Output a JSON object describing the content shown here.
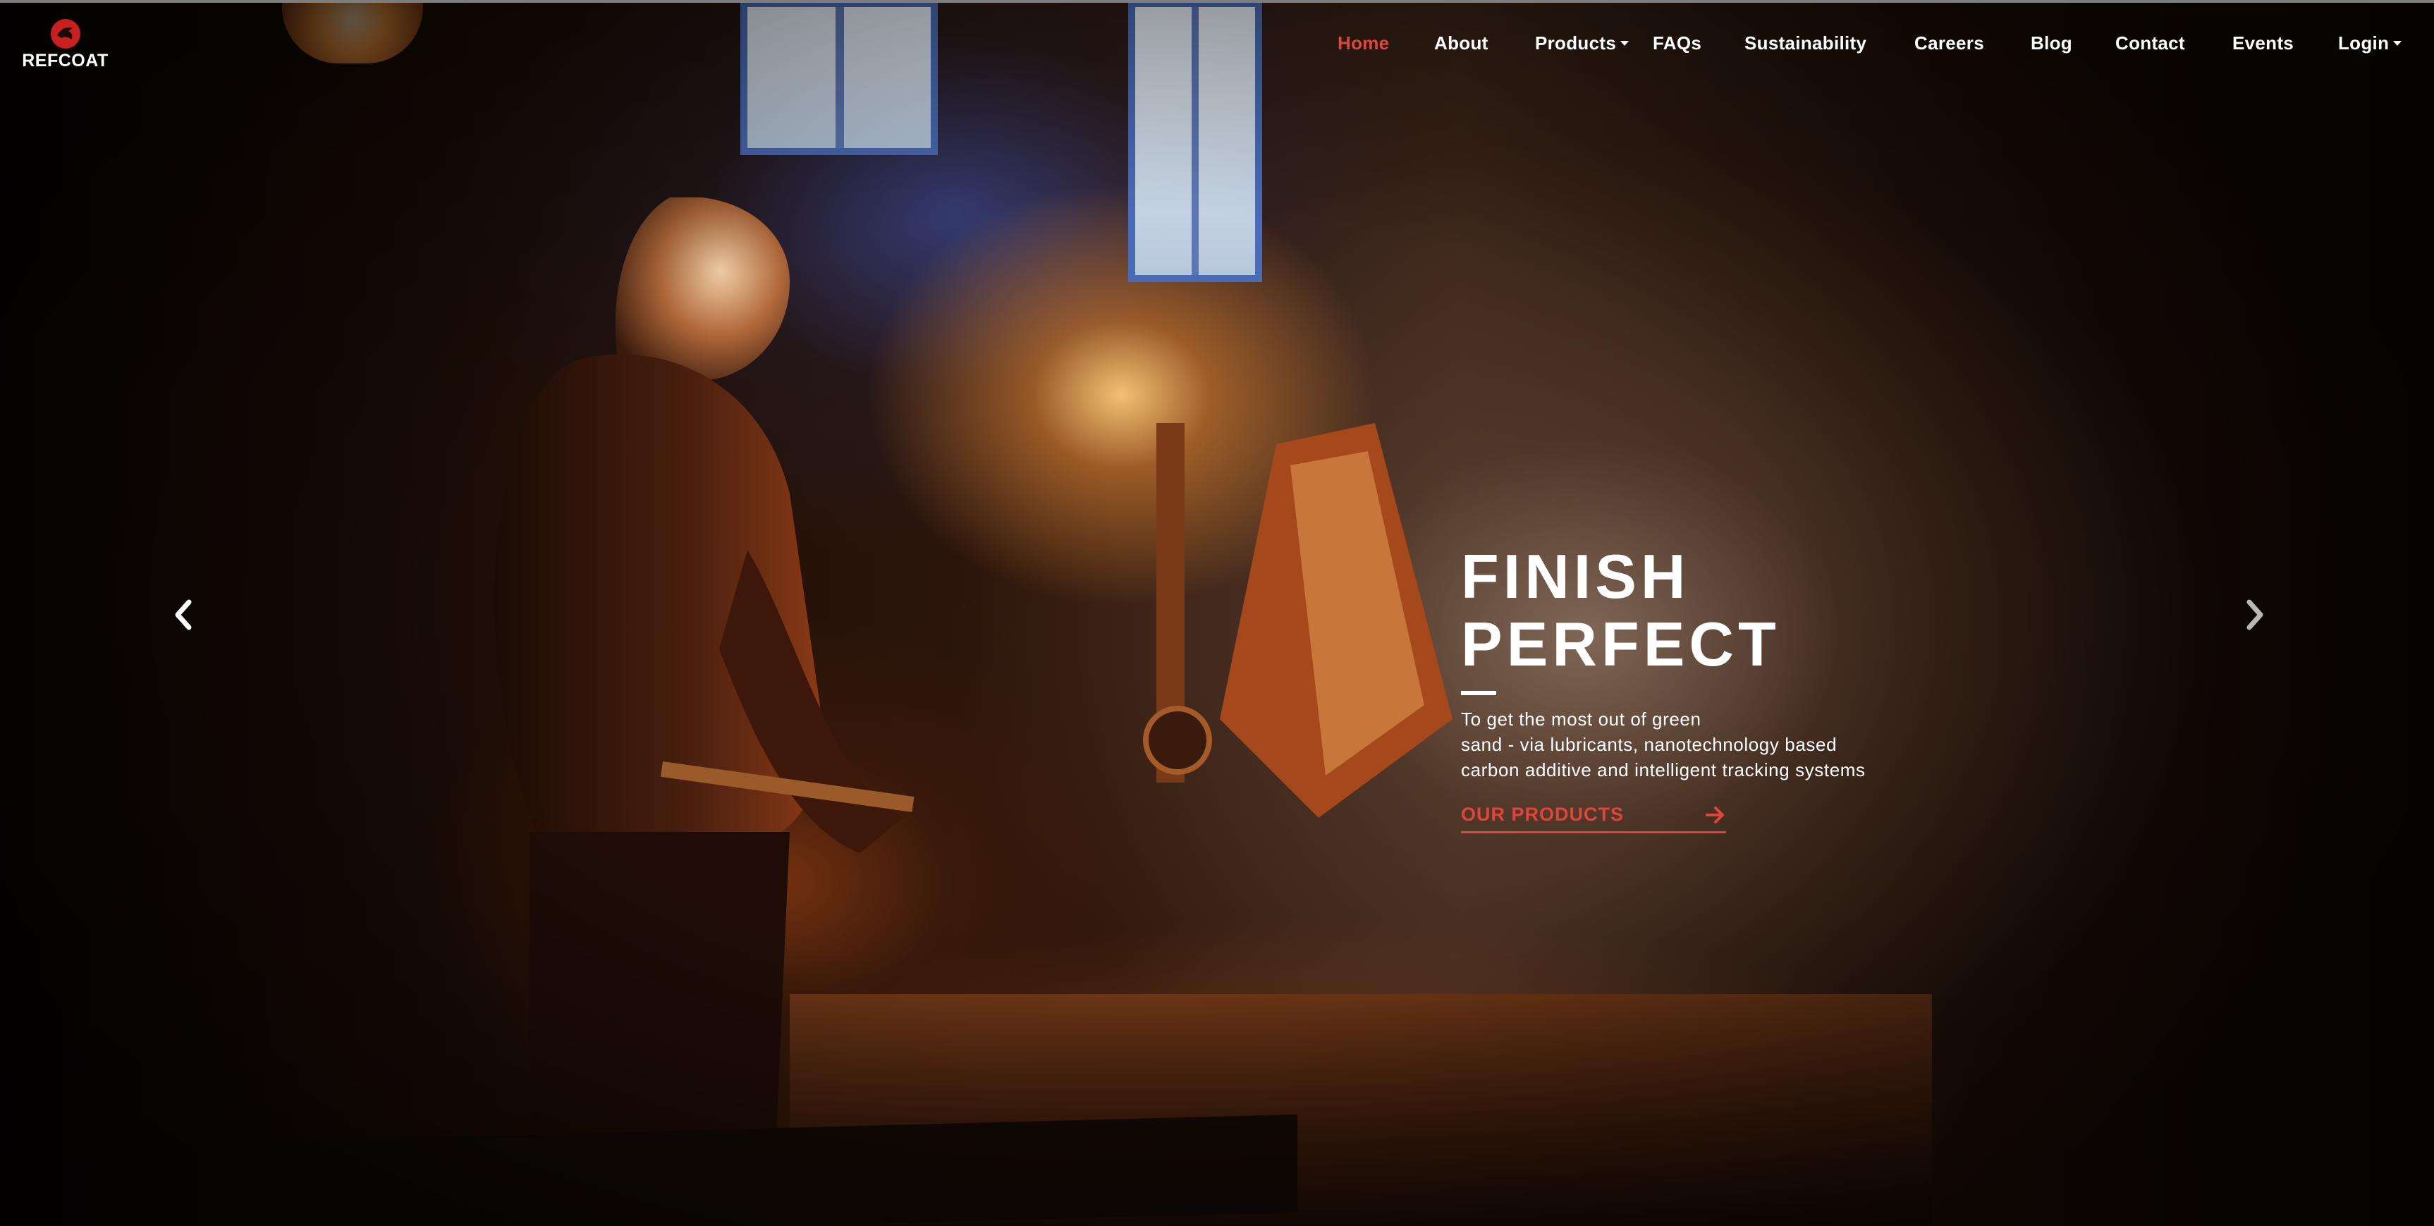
{
  "brand": {
    "name": "REFCOAT",
    "accent_color": "#e0453c"
  },
  "nav": {
    "items": [
      {
        "label": "Home",
        "active": true
      },
      {
        "label": "About"
      },
      {
        "label": "Products",
        "dropdown": true
      },
      {
        "label": "FAQs"
      },
      {
        "label": "Sustainability"
      },
      {
        "label": "Careers"
      },
      {
        "label": "Blog"
      },
      {
        "label": "Contact"
      },
      {
        "label": "Events"
      },
      {
        "label": "Login",
        "dropdown": true
      }
    ]
  },
  "hero": {
    "headline_line1": "FINISH",
    "headline_line2": "PERFECT",
    "description_line1": "To get the most out of green",
    "description_line2": "sand - via lubricants, nanotechnology based",
    "description_line3": "carbon additive and intelligent tracking systems",
    "cta_label": "OUR PRODUCTS"
  },
  "carousel": {
    "prev_icon": "chevron-left-icon",
    "next_icon": "chevron-right-icon"
  }
}
